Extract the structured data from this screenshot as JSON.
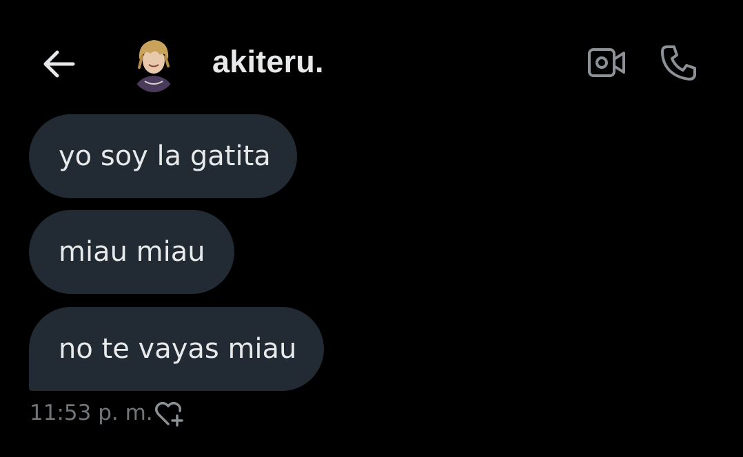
{
  "header": {
    "contact_name": "akiteru.",
    "icons": {
      "back": "arrow-left-icon",
      "video": "video-call-icon",
      "phone": "phone-call-icon"
    }
  },
  "messages": [
    {
      "text": "yo soy la gatita"
    },
    {
      "text": "miau miau"
    },
    {
      "text": "no te vayas miau"
    }
  ],
  "meta": {
    "timestamp": "11:53 p. m.",
    "reaction_icon": "heart-add-icon"
  },
  "colors": {
    "background": "#000000",
    "bubble": "#222b33",
    "text": "#e7e9ea",
    "muted": "#71767b"
  }
}
